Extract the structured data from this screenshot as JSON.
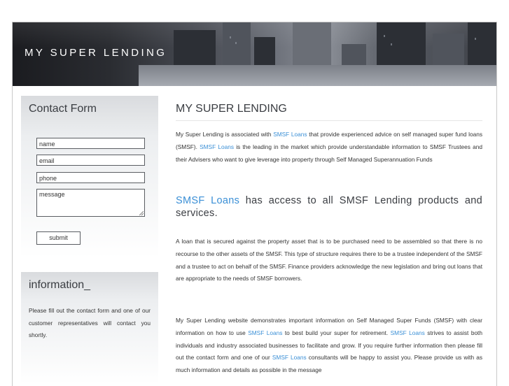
{
  "header": {
    "site_title": "MY SUPER LENDING"
  },
  "contact_form": {
    "title": "Contact Form",
    "name_value": "name",
    "email_value": "email",
    "phone_value": "phone",
    "message_value": "message",
    "submit_label": "submit"
  },
  "info": {
    "title": "information_",
    "text": "Please fill out the contact form and one of our customer representatives will contact you shortly."
  },
  "main": {
    "title": "MY SUPER LENDING",
    "link_label": "SMSF Loans",
    "p1": {
      "a": "My Super Lending is associated with ",
      "b": " that provide experienced advice on self managed super fund loans (SMSF). ",
      "c": " is the leading in the market which provide understandable information to SMSF Trustees and their Advisers who want to give leverage into property through Self Managed Superannuation Funds"
    },
    "subhead_rest": " has access to all SMSF Lending products and services.",
    "p2": "A loan that is secured against the property asset that is to be purchased need to be assembled so that there is no recourse to the other assets of the SMSF. This type of structure requires there to be a trustee independent of the SMSF and a trustee to act on behalf of the SMSF. Finance providers acknowledge the new legislation and bring out loans that are appropriate to the needs of SMSF borrowers.",
    "p3": {
      "a": "My Super Lending website demonstrates important information on Self Managed Super Funds (SMSF) with clear information on how to use ",
      "b": " to best build your super for retirement. ",
      "c": " strives to assist both individuals and industry associated businesses to facilitate and grow. If you require further information then please fill out the contact form and one of our ",
      "d": " consultants will be happy to assist you. Please provide us with as much information and details as possible in the message"
    }
  }
}
